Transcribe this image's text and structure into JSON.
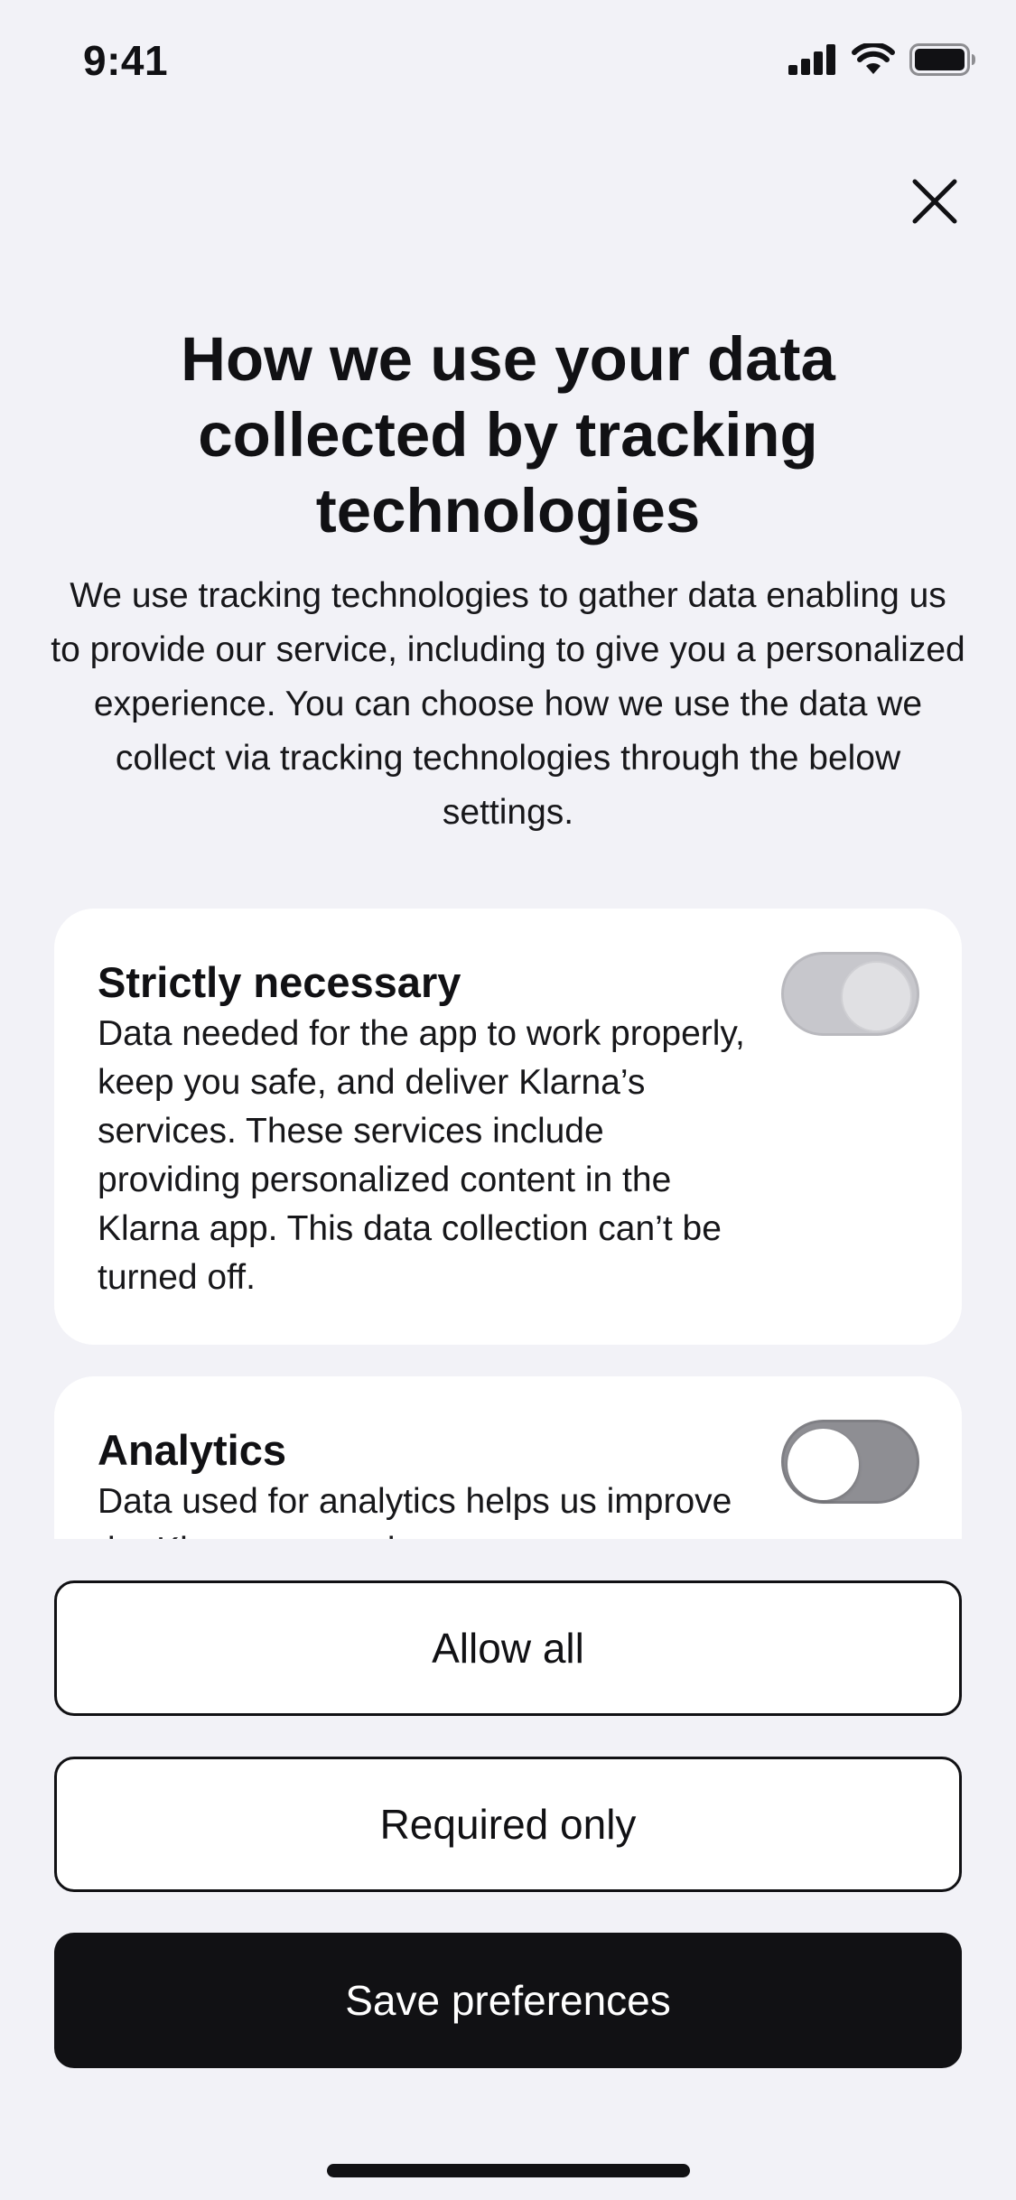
{
  "status_bar": {
    "time": "9:41",
    "icons": [
      "cellular-signal-icon",
      "wifi-icon",
      "battery-icon"
    ]
  },
  "header": {
    "close_icon": "close-icon"
  },
  "title": "How we use your data collected by tracking technologies",
  "intro": "We use tracking technologies to gather data enabling us to provide our service, including to give you a personalized experience. You can choose how we use the data we collect via tracking technologies through the below settings.",
  "categories": [
    {
      "title": "Strictly necessary",
      "description": "Data needed for the app to work properly, keep you safe, and deliver Klarna’s services. These services include providing personalized content in the Klarna app. This data collection can’t be turned off.",
      "toggle": {
        "on": true,
        "disabled": true
      }
    },
    {
      "title": "Analytics",
      "description": "Data used for analytics helps us improve the Klarna app and",
      "toggle": {
        "on": false,
        "disabled": false
      }
    }
  ],
  "actions": {
    "allow_all": "Allow all",
    "required_only": "Required only",
    "save_preferences": "Save preferences"
  },
  "colors": {
    "background": "#f2f2f7",
    "card": "#ffffff",
    "primary": "#111114",
    "toggle_disabled": "#c7c7cc",
    "toggle_off": "#8e8e93"
  }
}
